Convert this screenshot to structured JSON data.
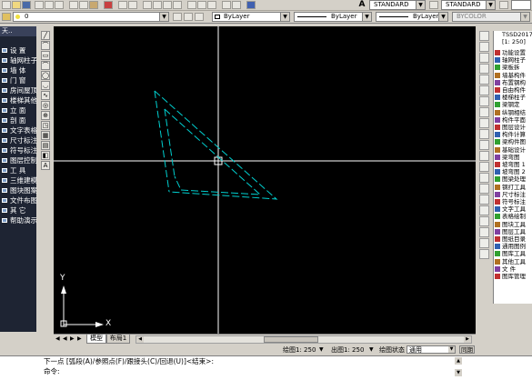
{
  "toolbar": {
    "layer_value": "0",
    "color_value": "ByLayer",
    "linetype_value": "ByLayer",
    "lineweight_value": "ByLayer",
    "plotstyle_value": "BYCOLOR",
    "textstyle_value": "STANDARD",
    "dimstyle_value": "STANDARD",
    "a_icon": "A"
  },
  "left_menu": {
    "title": "天..",
    "items": [
      "设  置",
      "轴网柱子",
      "墙    体",
      "门    窗",
      "房间屋顶",
      "楼梯其他",
      "立    面",
      "剖    面",
      "文字表格",
      "尺寸标注",
      "符号标注",
      "图层控制",
      "工    具",
      "三维建模",
      "图块图案",
      "文件布图",
      "其    它",
      "帮助演示"
    ]
  },
  "draw_tools": [
    "╱",
    "⌒",
    "▭",
    "⌒",
    "◯",
    "◡",
    "∿",
    "◎",
    "⊕",
    "◳",
    "▦",
    "▤",
    "◧",
    "A"
  ],
  "ucs": {
    "y_label": "Y",
    "x_label": "X"
  },
  "tabs": {
    "model": "模型",
    "layout": "布局1"
  },
  "status": {
    "plot_scale_label": "绘图1: 250",
    "out_scale_label": "出图1: 250",
    "state_label": "绘图状态",
    "state_value": "通用",
    "right_button": "同期"
  },
  "command": {
    "line1": "下一点 [弧段(A)/参照点(F)/跟接头(C)/回退(U)]<结束>:",
    "line2": "命令:"
  },
  "right_panel": {
    "header1": "TSSD2017",
    "header2": "[1: 250]",
    "items": [
      "功能设置",
      "轴网柱子",
      "梁板拆",
      "墙基构件",
      "布置钢构",
      "自由构件",
      "楼梯柱子",
      "梁钢定",
      "纵钢相结",
      "构件平面",
      "图层设计",
      "构件计算",
      "梁构件图",
      "基础设计",
      "梁弯图",
      "坡弯图 1",
      "坡弯图 2",
      "图梁处理",
      "钢打工具",
      "尺寸标注",
      "符号标注",
      "文字工具",
      "表格绘制",
      "图块工具",
      "图层工具",
      "图纸目录",
      "通用图例",
      "图库工具",
      "其他工具",
      "文  件",
      "图库管理"
    ]
  },
  "colors": {
    "canvas": "#000000",
    "panel": "#d4d0c8",
    "dark_panel": "#1e2433",
    "triangle": "#00d0d0",
    "crosshair": "#ffffff"
  }
}
